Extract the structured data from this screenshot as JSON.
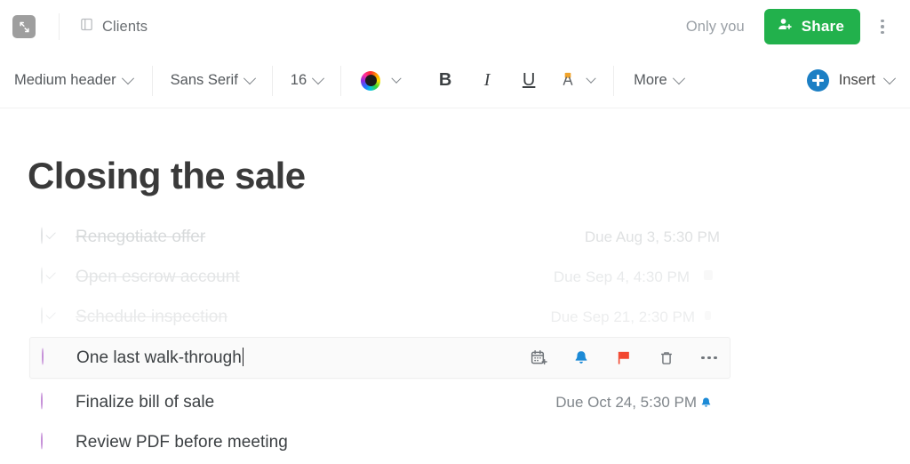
{
  "topbar": {
    "expand_icon": "expand-arrows-icon",
    "doc_icon": "note-document-icon",
    "doc_title": "Clients",
    "sharing_status": "Only you",
    "share_label": "Share",
    "share_icon": "person-add-icon",
    "overflow_icon": "kebab-menu-icon",
    "share_color": "#22b14c"
  },
  "toolbar": {
    "paragraph_style": "Medium header",
    "font_family": "Sans Serif",
    "font_size": "16",
    "text_color_icon": "color-wheel-icon",
    "bold_label": "B",
    "italic_label": "I",
    "underline_label": "U",
    "highlight_icon": "text-highlight-icon",
    "more_label": "More",
    "insert_label": "Insert",
    "insert_icon": "plus-circle-icon",
    "insert_color": "#1c7fc4",
    "highlight_color": "#f0a32a"
  },
  "document": {
    "title": "Closing the sale",
    "tasks": [
      {
        "label": "Renegotiate offer",
        "due": "Due Aug 3, 5:30 PM",
        "done": true,
        "selected": false,
        "reminder": false
      },
      {
        "label": "Open escrow account",
        "due": "Due Sep 4, 4:30 PM",
        "done": true,
        "selected": false,
        "reminder": false
      },
      {
        "label": "Schedule inspection",
        "due": "Due Sep 21, 2:30 PM",
        "done": true,
        "selected": false,
        "reminder": false
      },
      {
        "label": "One last walk-through",
        "due": "",
        "done": false,
        "selected": true,
        "reminder": false
      },
      {
        "label": "Finalize bill of sale",
        "due": "Due Oct 24, 5:30 PM",
        "done": false,
        "selected": false,
        "reminder": true
      },
      {
        "label": "Review PDF before meeting",
        "due": "",
        "done": false,
        "selected": false,
        "reminder": false
      }
    ],
    "bullet_color": "#c58fd8",
    "row_actions": [
      {
        "name": "add-to-calendar-icon",
        "color": "#70757a"
      },
      {
        "name": "reminder-bell-icon",
        "color": "#1c8ad6"
      },
      {
        "name": "flag-icon",
        "color": "#f2462e"
      },
      {
        "name": "delete-trash-icon",
        "color": "#70757a"
      },
      {
        "name": "more-options-icon",
        "color": "#70757a"
      }
    ]
  }
}
